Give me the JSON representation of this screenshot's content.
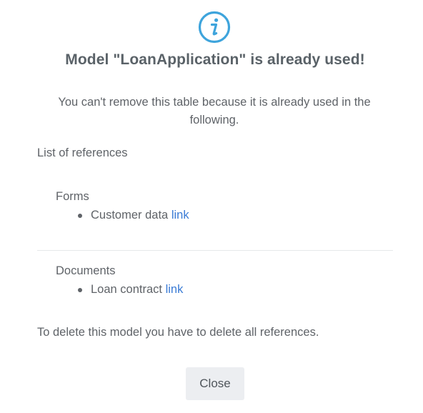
{
  "dialog": {
    "icon": "info-circle-icon",
    "title": "Model \"LoanApplication\" is already used!",
    "message": "You can't remove this table because it is already used in the following.",
    "references_heading": "List of references",
    "sections": [
      {
        "title": "Forms",
        "items": [
          {
            "label": "Customer data",
            "link_text": "link"
          }
        ]
      },
      {
        "title": "Documents",
        "items": [
          {
            "label": "Loan contract",
            "link_text": "link"
          }
        ]
      }
    ],
    "footer_text": "To delete this model you have to delete all references.",
    "close_label": "Close"
  },
  "colors": {
    "icon": "#3ea4dc",
    "text": "#5f6368",
    "link": "#3a7bd5",
    "button_bg": "#eceef1",
    "divider": "#e6e8ea"
  }
}
